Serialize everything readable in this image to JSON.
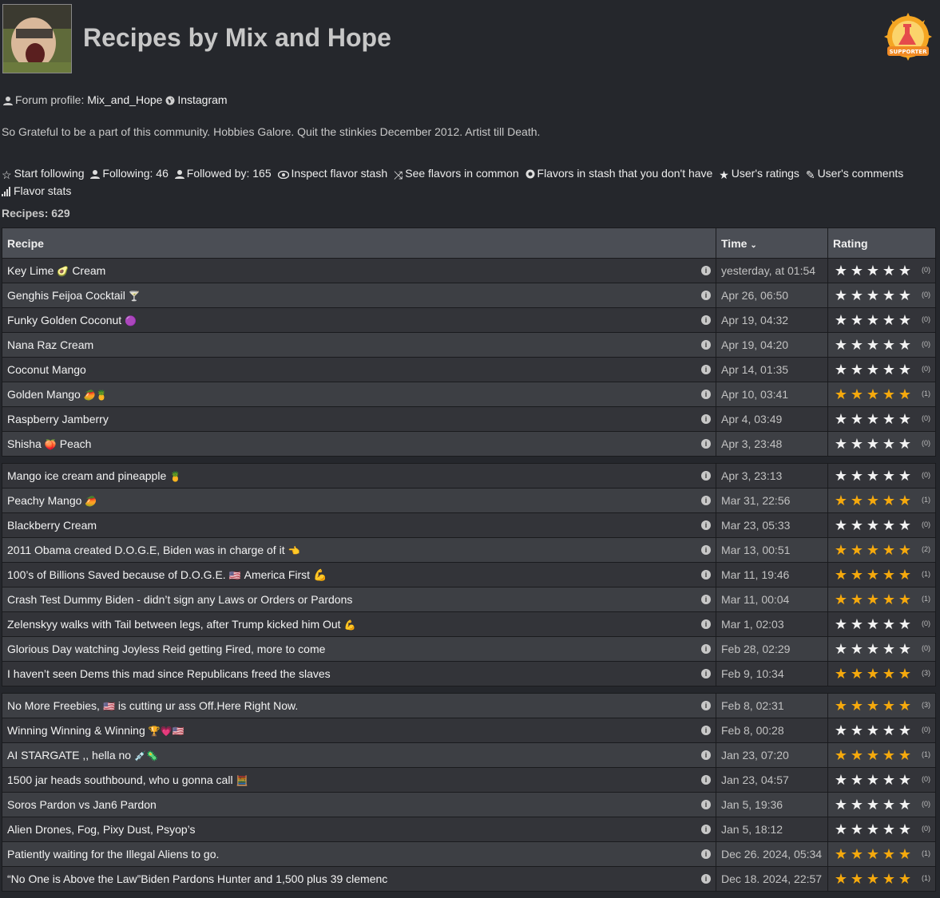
{
  "header": {
    "title": "Recipes by Mix and Hope",
    "badge_text": "SUPPORTER"
  },
  "profile": {
    "forum_label": "Forum profile:",
    "forum_name": "Mix_and_Hope",
    "instagram_label": "Instagram"
  },
  "bio": "So Grateful to be a part of this community. Hobbies Galore. Quit the stinkies December 2012. Artist till Death.",
  "actions": {
    "start_following": "Start following",
    "following": "Following: 46",
    "followed_by": "Followed by: 165",
    "inspect_stash": "Inspect flavor stash",
    "flavors_common": "See flavors in common",
    "flavors_missing": "Flavors in stash that you don't have",
    "user_ratings": "User's ratings",
    "user_comments": "User's comments",
    "flavor_stats": "Flavor stats"
  },
  "recipes_count": "Recipes: 629",
  "table": {
    "headers": {
      "recipe": "Recipe",
      "time": "Time",
      "rating": "Rating"
    },
    "rows": [
      {
        "name": "Key Lime",
        "emoji": "🥑",
        "suffix": "Cream",
        "time": "yesterday, at 01:54",
        "stars": 0,
        "count": "(0)"
      },
      {
        "name": "Genghis Feijoa Cocktail",
        "emoji": "🍸",
        "time": "Apr 26, 06:50",
        "stars": 0,
        "count": "(0)"
      },
      {
        "name": "Funky Golden Coconut",
        "emoji": "🟣",
        "time": "Apr 19, 04:32",
        "stars": 0,
        "count": "(0)"
      },
      {
        "name": "Nana Raz Cream",
        "emoji": "",
        "time": "Apr 19, 04:20",
        "stars": 0,
        "count": "(0)"
      },
      {
        "name": "Coconut Mango",
        "emoji": "",
        "time": "Apr 14, 01:35",
        "stars": 0,
        "count": "(0)"
      },
      {
        "name": "Golden Mango",
        "emoji": "🥭🍍",
        "time": "Apr 10, 03:41",
        "stars": 5,
        "count": "(1)"
      },
      {
        "name": "Raspberry Jamberry",
        "emoji": "",
        "time": "Apr 4, 03:49",
        "stars": 0,
        "count": "(0)"
      },
      {
        "name": "Shisha",
        "emoji": "🍑",
        "suffix": "Peach",
        "time": "Apr 3, 23:48",
        "stars": 0,
        "count": "(0)",
        "gap_after": true
      },
      {
        "name": "Mango ice cream and pineapple",
        "emoji": "🍍",
        "time": "Apr 3, 23:13",
        "stars": 0,
        "count": "(0)"
      },
      {
        "name": "Peachy Mango",
        "emoji": "🥭",
        "time": "Mar 31, 22:56",
        "stars": 5,
        "count": "(1)"
      },
      {
        "name": "Blackberry Cream",
        "emoji": "",
        "time": "Mar 23, 05:33",
        "stars": 0,
        "count": "(0)"
      },
      {
        "name": "2011 Obama created D.O.G.E, Biden was in charge of it",
        "emoji": "👈",
        "time": "Mar 13, 00:51",
        "stars": 5,
        "count": "(2)"
      },
      {
        "name": "100’s of Billions Saved because of D.O.G.E.",
        "emoji": "🇺🇸",
        "suffix": "America First 💪",
        "time": "Mar 11, 19:46",
        "stars": 5,
        "count": "(1)"
      },
      {
        "name": "Crash Test Dummy Biden - didn’t sign any Laws or Orders or Pardons",
        "emoji": "",
        "time": "Mar 11, 00:04",
        "stars": 5,
        "count": "(1)"
      },
      {
        "name": "Zelenskyy walks with Tail between legs, after Trump kicked him Out",
        "emoji": "💪",
        "time": "Mar 1, 02:03",
        "stars": 0,
        "count": "(0)"
      },
      {
        "name": "Glorious Day watching Joyless Reid getting Fired, more to come",
        "emoji": "",
        "time": "Feb 28, 02:29",
        "stars": 0,
        "count": "(0)"
      },
      {
        "name": "I haven’t seen Dems this mad since Republicans freed the slaves",
        "emoji": "",
        "time": "Feb 9, 10:34",
        "stars": 5,
        "count": "(3)",
        "gap_after": true
      },
      {
        "name": "No More Freebies,",
        "emoji": "🇺🇸",
        "suffix": "is cutting ur ass Off.Here Right Now.",
        "time": "Feb 8, 02:31",
        "stars": 5,
        "count": "(3)"
      },
      {
        "name": "Winning Winning & Winning",
        "emoji": "🏆💗🇺🇸",
        "time": "Feb 8, 00:28",
        "stars": 0,
        "count": "(0)"
      },
      {
        "name": "AI STARGATE ,, hella no",
        "emoji": "💉🦠",
        "time": "Jan 23, 07:20",
        "stars": 5,
        "count": "(1)"
      },
      {
        "name": "1500 jar heads southbound, who u gonna call",
        "emoji": "🧮",
        "time": "Jan 23, 04:57",
        "stars": 0,
        "count": "(0)"
      },
      {
        "name": "Soros Pardon vs Jan6 Pardon",
        "emoji": "",
        "time": "Jan 5, 19:36",
        "stars": 0,
        "count": "(0)"
      },
      {
        "name": "Alien Drones, Fog, Pixy Dust, Psyop’s",
        "emoji": "",
        "time": "Jan 5, 18:12",
        "stars": 0,
        "count": "(0)"
      },
      {
        "name": "Patiently waiting for the Illegal Aliens to go.",
        "emoji": "",
        "time": "Dec 26. 2024, 05:34",
        "stars": 5,
        "count": "(1)"
      },
      {
        "name": "“No One is Above the Law”Biden Pardons Hunter and 1,500 plus 39 clemenc",
        "emoji": "",
        "time": "Dec 18. 2024, 22:57",
        "stars": 5,
        "count": "(1)"
      }
    ]
  }
}
